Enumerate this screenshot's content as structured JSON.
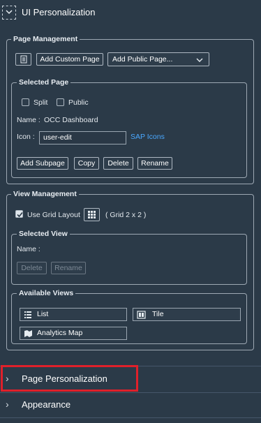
{
  "header": {
    "title": "UI Personalization"
  },
  "page_management": {
    "legend": "Page Management",
    "add_custom_page": "Add Custom Page",
    "add_public_page": "Add Public Page..."
  },
  "selected_page": {
    "legend": "Selected Page",
    "split_label": "Split",
    "public_label": "Public",
    "name_label": "Name :",
    "name_value": "OCC Dashboard",
    "icon_label": "Icon :",
    "icon_value": "user-edit",
    "sap_icons_link": "SAP Icons",
    "add_subpage": "Add Subpage",
    "copy": "Copy",
    "delete": "Delete",
    "rename": "Rename"
  },
  "view_management": {
    "legend": "View Management",
    "use_grid_layout": "Use Grid Layout",
    "grid_info": "( Grid 2 x 2 )"
  },
  "selected_view": {
    "legend": "Selected View",
    "name_label": "Name :",
    "delete": "Delete",
    "rename": "Rename"
  },
  "available_views": {
    "legend": "Available Views",
    "items": [
      {
        "label": "List",
        "icon": "list-icon"
      },
      {
        "label": "Tile",
        "icon": "tile-icon"
      },
      {
        "label": "Analytics Map",
        "icon": "map-icon"
      }
    ]
  },
  "sections": {
    "page_personalization": "Page Personalization",
    "appearance": "Appearance"
  },
  "colors": {
    "background": "#2b3a48",
    "link": "#4aa8ff",
    "highlight": "#e0202a"
  }
}
